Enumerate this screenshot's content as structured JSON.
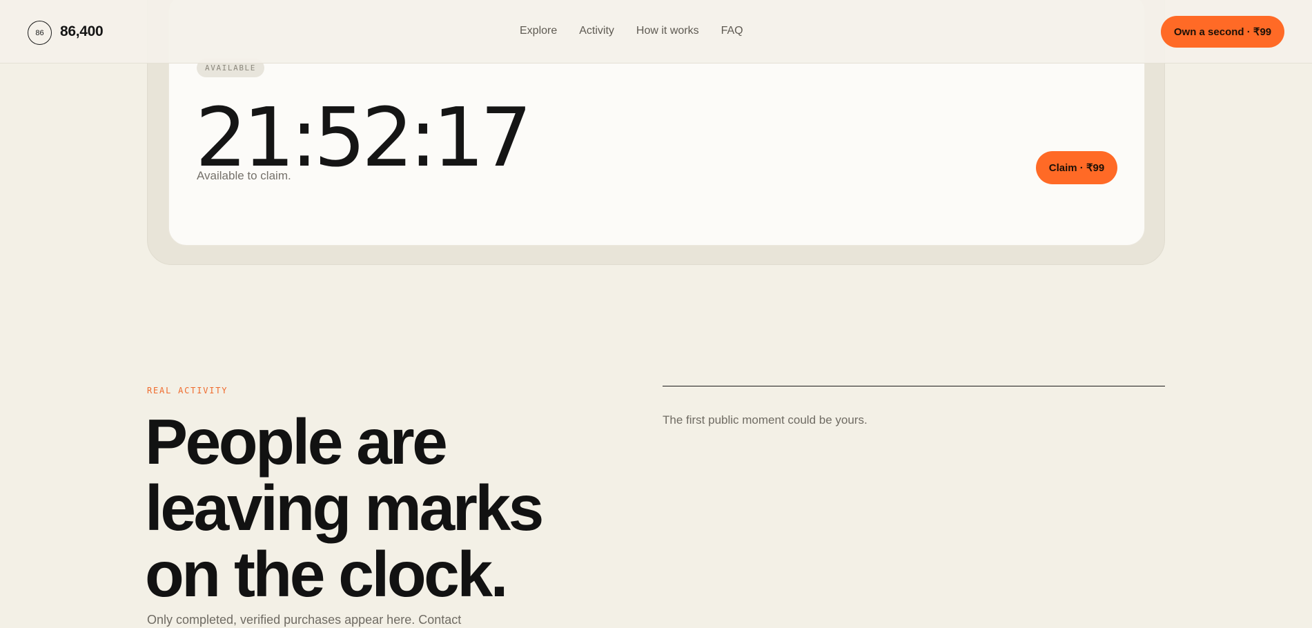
{
  "header": {
    "logo_mark": "86",
    "logo_text": "86,400",
    "nav": [
      "Explore",
      "Activity",
      "How it works",
      "FAQ"
    ],
    "cta_label": "Own a second · ₹99"
  },
  "card": {
    "badge": "AVAILABLE",
    "time": "21:52:17",
    "note": "Available to claim.",
    "claim_label": "Claim · ₹99"
  },
  "activity": {
    "eyebrow": "REAL ACTIVITY",
    "headline_lines": [
      "People are",
      "leaving marks",
      "on the clock."
    ],
    "subtext": "Only completed, verified purchases appear here. Contact",
    "empty_note": "The first public moment could be yours."
  },
  "colors": {
    "accent": "#ff6a26",
    "background": "#f3f0e6",
    "card_outer": "#e8e4d8",
    "card_inner": "#fcfbf8"
  }
}
